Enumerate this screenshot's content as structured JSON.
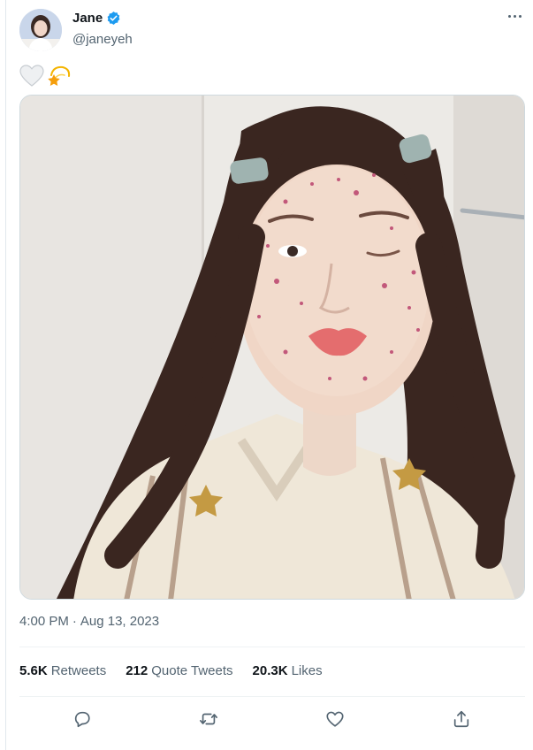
{
  "tweet": {
    "author": {
      "name": "Jane",
      "handle": "@janeyeh",
      "verified": true
    },
    "text_emojis": [
      "white-heart-icon",
      "dizzy-star-icon"
    ],
    "time": "4:00 PM",
    "separator": "·",
    "date": "Aug 13, 2023",
    "stats": {
      "retweets": {
        "count": "5.6K",
        "label": "Retweets"
      },
      "quotes": {
        "count": "212",
        "label": "Quote Tweets"
      },
      "likes": {
        "count": "20.3K",
        "label": "Likes"
      }
    },
    "actions": [
      "reply-icon",
      "retweet-icon",
      "like-icon",
      "share-icon"
    ]
  },
  "colors": {
    "text_primary": "#0f1419",
    "text_secondary": "#536471",
    "verified_blue": "#1d9bf0",
    "border": "#cfd9de"
  }
}
